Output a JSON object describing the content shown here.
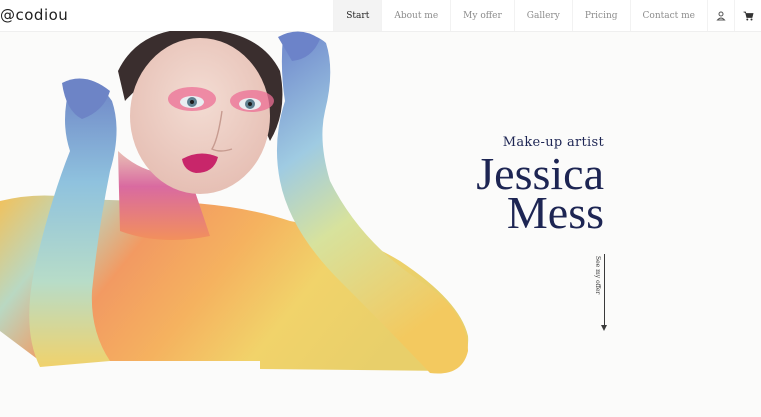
{
  "brand": {
    "logo_text": "@codiou"
  },
  "nav": {
    "items": [
      {
        "label": "Start",
        "active": true
      },
      {
        "label": "About me"
      },
      {
        "label": "My offer"
      },
      {
        "label": "Gallery"
      },
      {
        "label": "Pricing"
      },
      {
        "label": "Contact me"
      }
    ],
    "icons": [
      "user-icon",
      "cart-icon"
    ]
  },
  "hero": {
    "subtitle": "Make-up artist",
    "name_line1": "Jessica",
    "name_line2": "Mess",
    "see_offer": "See my offer"
  },
  "colors": {
    "heading": "#1d2553",
    "active_nav_bg": "#f3f3f3",
    "background": "#fbfbfa"
  }
}
